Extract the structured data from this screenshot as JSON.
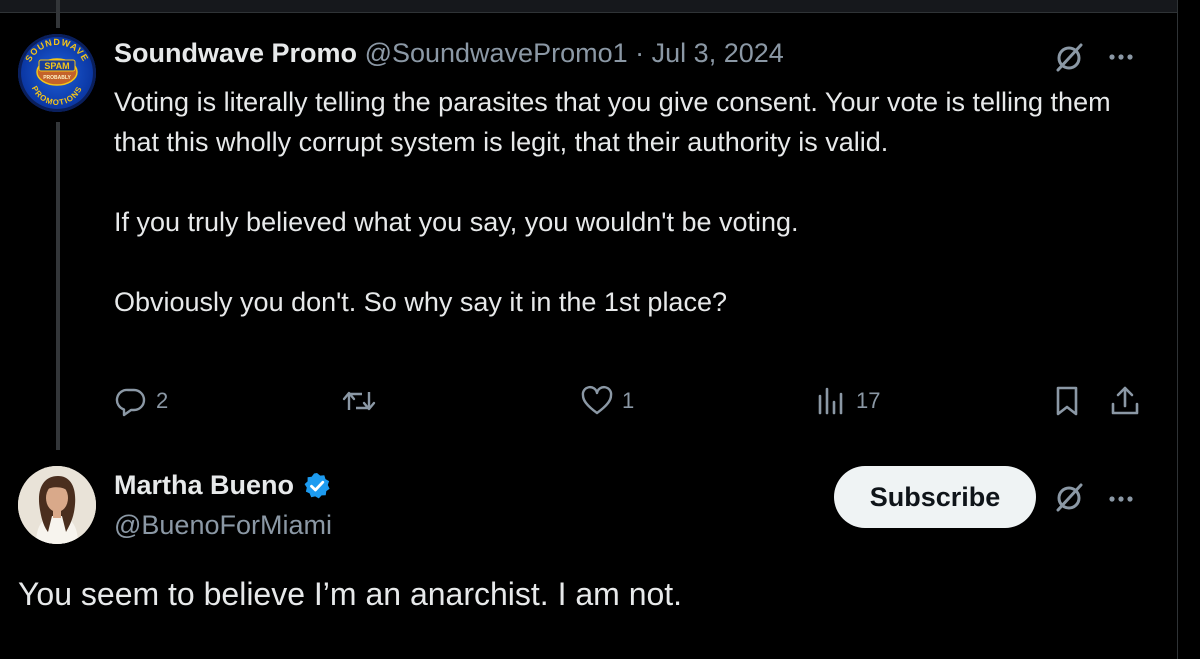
{
  "tweet1": {
    "display_name": "Soundwave Promo",
    "handle": "@SoundwavePromo1",
    "separator": "·",
    "date": "Jul 3, 2024",
    "avatar_logo": {
      "top_text": "SOUNDWAVE",
      "badge_text": "SPAM",
      "sub_badge_text": "PROBABLY",
      "bottom_text": "PROMOTIONS"
    },
    "body": [
      "Voting is literally telling the parasites that you give consent. Your vote is telling them that this wholly corrupt system is legit, that their authority is valid.",
      "If you truly believed what you say, you wouldn't be voting.",
      "Obviously you don't. So why say it in the 1st place?"
    ],
    "actions": {
      "replies": "2",
      "retweets": "",
      "likes": "1",
      "views": "17"
    },
    "icons": {
      "grok": "grok-slash-icon",
      "more": "more-dots-icon",
      "reply": "reply-bubble-icon",
      "retweet": "retweet-icon",
      "like": "heart-icon",
      "views": "views-bars-icon",
      "bookmark": "bookmark-icon",
      "share": "share-icon"
    }
  },
  "tweet2": {
    "display_name": "Martha Bueno",
    "handle": "@BuenoForMiami",
    "verified": true,
    "subscribe_label": "Subscribe",
    "body": "You seem to believe I’m an anarchist. I am not."
  },
  "colors": {
    "background": "#000000",
    "text_primary": "#e7e9ea",
    "text_secondary": "#8b98a5",
    "verified_blue": "#1d9bf0",
    "subscribe_bg": "#eff3f4",
    "thread_line": "#333639"
  }
}
